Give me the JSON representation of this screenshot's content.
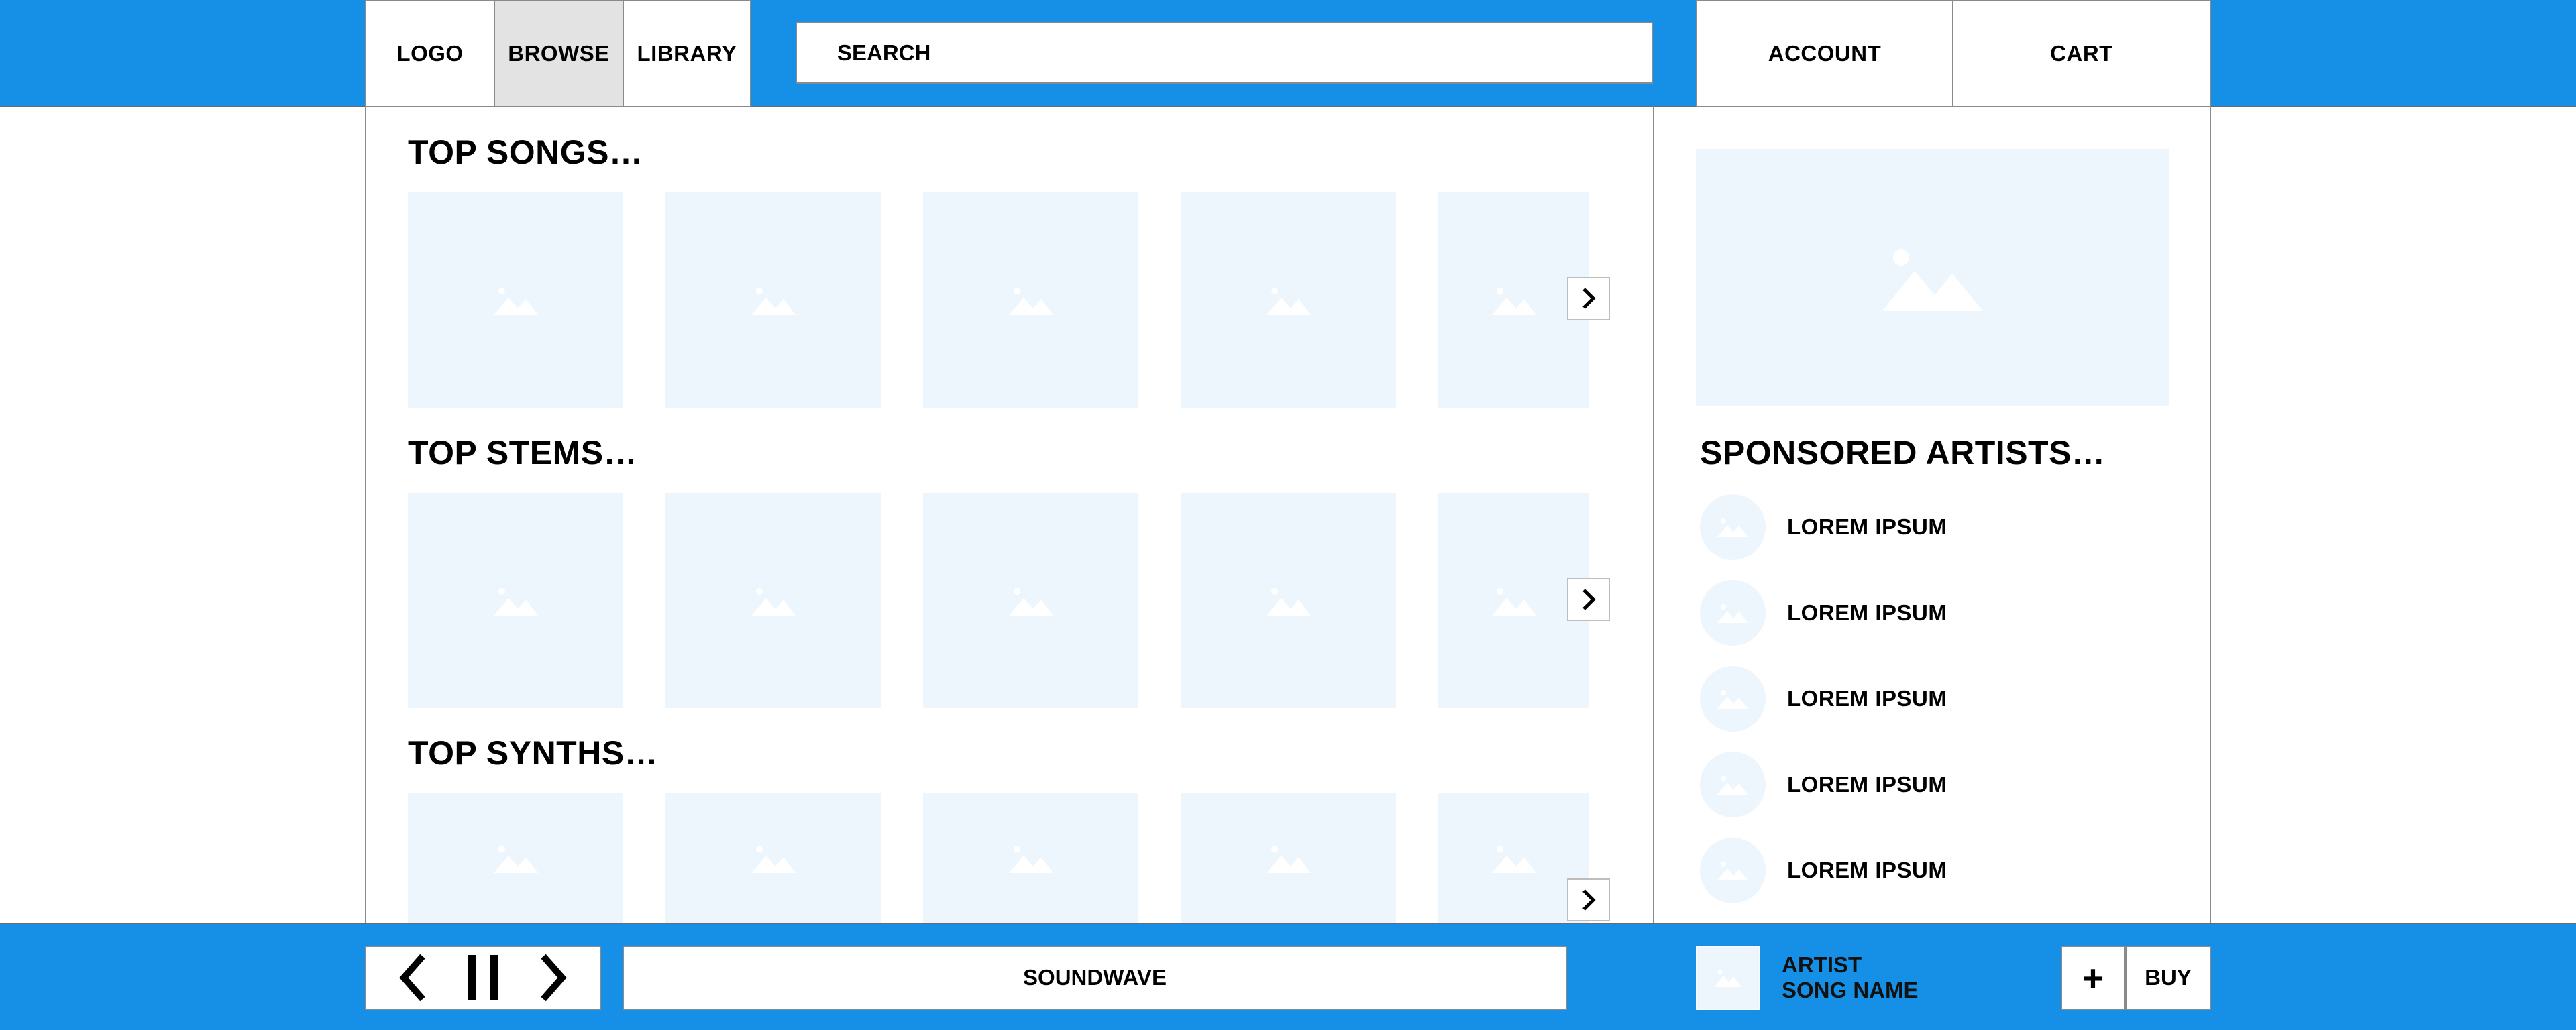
{
  "nav": {
    "logo": "LOGO",
    "browse": "BROWSE",
    "library": "LIBRARY",
    "search_label": "SEARCH",
    "account": "ACCOUNT",
    "cart": "CART"
  },
  "sections": [
    {
      "title": "TOP SONGS…"
    },
    {
      "title": "TOP STEMS…"
    },
    {
      "title": "TOP SYNTHS…"
    }
  ],
  "sidebar": {
    "title": "SPONSORED ARTISTS…",
    "artists": [
      {
        "name": "LOREM IPSUM"
      },
      {
        "name": "LOREM IPSUM"
      },
      {
        "name": "LOREM IPSUM"
      },
      {
        "name": "LOREM IPSUM"
      },
      {
        "name": "LOREM IPSUM"
      }
    ]
  },
  "player": {
    "waveform_label": "SOUNDWAVE",
    "artist": "ARTIST",
    "song": "SONG NAME",
    "add_label": "+",
    "buy_label": "BUY"
  },
  "icons": {
    "image_placeholder": "image-icon",
    "next": "chevron-right-icon",
    "prev": "chevron-left-icon",
    "pause": "pause-icon"
  },
  "colors": {
    "bar": "#1690e6",
    "placeholder": "#eef6fd",
    "active_tab": "#e3e3e3"
  }
}
